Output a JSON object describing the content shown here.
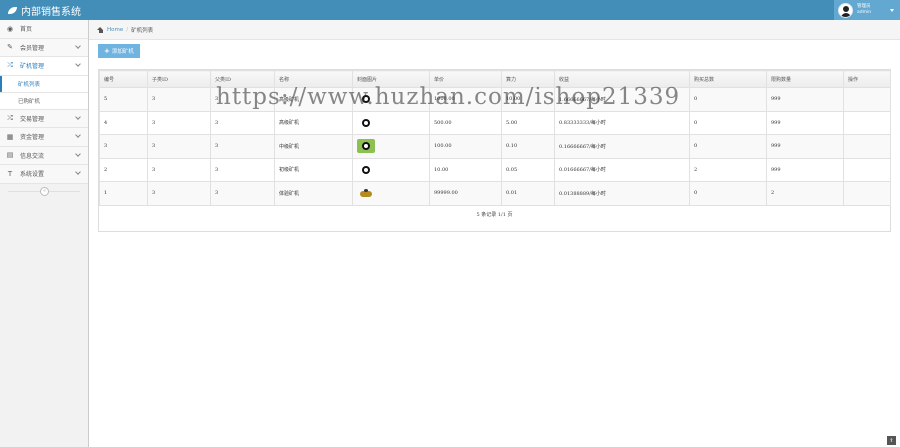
{
  "app": {
    "title": "内部销售系统"
  },
  "user": {
    "role": "管理员",
    "name": "admin"
  },
  "sidebar": {
    "items": [
      {
        "label": "首页",
        "icon": "tachometer-icon"
      },
      {
        "label": "会员管理",
        "icon": "edit-icon"
      },
      {
        "label": "矿机管理",
        "icon": "random-icon"
      },
      {
        "label": "交易管理",
        "icon": "random-icon"
      },
      {
        "label": "资金管理",
        "icon": "calendar-icon"
      },
      {
        "label": "信息交流",
        "icon": "list-icon"
      },
      {
        "label": "系统设置",
        "icon": "text-width-icon"
      }
    ],
    "subitems": [
      {
        "label": "矿机列表"
      },
      {
        "label": "已购矿机"
      }
    ],
    "collapse_glyph": "«"
  },
  "breadcrumb": {
    "home": "Home",
    "current": "矿机列表"
  },
  "toolbar": {
    "add_label": "添加矿机"
  },
  "table": {
    "headers": [
      "编号",
      "子类ID",
      "父类ID",
      "名称",
      "封面图片",
      "单价",
      "算力",
      "收益",
      "购买总数",
      "限购数量",
      "操作"
    ],
    "rows": [
      {
        "id": "5",
        "sub": "3",
        "parent": "3",
        "name": "高级矿机",
        "price": "1000.00",
        "power": "10.00",
        "income": "1.66666667/每小时",
        "bought": "0",
        "limit": "999",
        "op": ""
      },
      {
        "id": "4",
        "sub": "3",
        "parent": "3",
        "name": "高级矿机",
        "price": "500.00",
        "power": "5.00",
        "income": "0.83333333/每小时",
        "bought": "0",
        "limit": "999",
        "op": ""
      },
      {
        "id": "3",
        "sub": "3",
        "parent": "3",
        "name": "中级矿机",
        "price": "100.00",
        "power": "0.10",
        "income": "0.16666667/每小时",
        "bought": "0",
        "limit": "999",
        "op": ""
      },
      {
        "id": "2",
        "sub": "3",
        "parent": "3",
        "name": "初级矿机",
        "price": "10.00",
        "power": "0.05",
        "income": "0.01666667/每小时",
        "bought": "2",
        "limit": "999",
        "op": ""
      },
      {
        "id": "1",
        "sub": "3",
        "parent": "3",
        "name": "体验矿机",
        "price": "99999.00",
        "power": "0.01",
        "income": "0.01388889/每小时",
        "bought": "0",
        "limit": "2",
        "op": ""
      }
    ],
    "footer": "5 条记录 1/1 页"
  },
  "watermark": "https://www.huzhan.com/ishop21339",
  "colors": {
    "topbar": "#438eb9",
    "user_area": "#62a8d1",
    "accent": "#2b7dbc",
    "button": "#6fb3e0"
  }
}
